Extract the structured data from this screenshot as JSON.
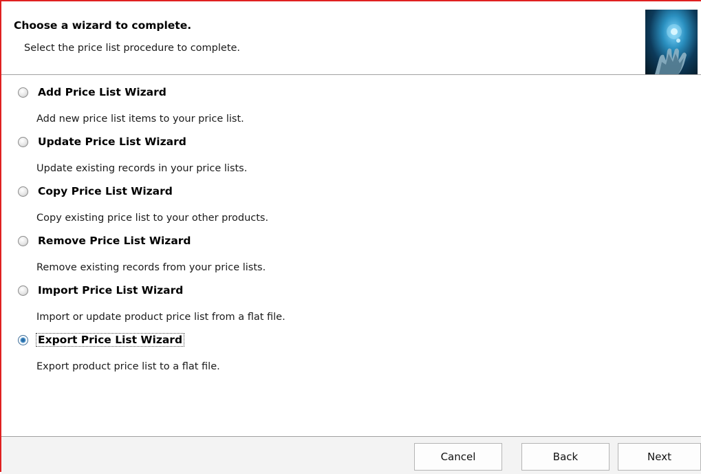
{
  "header": {
    "title": "Choose a wizard to complete.",
    "subtitle": "Select the price list procedure to complete."
  },
  "options": [
    {
      "title": "Add Price List Wizard",
      "description": "Add new price list items to your price list.",
      "selected": false
    },
    {
      "title": "Update Price List Wizard",
      "description": "Update existing records in your price lists.",
      "selected": false
    },
    {
      "title": "Copy Price List Wizard",
      "description": "Copy existing price list to your other products.",
      "selected": false
    },
    {
      "title": "Remove Price List Wizard",
      "description": "Remove existing records from your price lists.",
      "selected": false
    },
    {
      "title": "Import Price List Wizard",
      "description": "Import or update product price list from a flat file.",
      "selected": false
    },
    {
      "title": "Export Price List Wizard",
      "description": "Export product price list to a flat file.",
      "selected": true
    }
  ],
  "footer": {
    "cancel_label": "Cancel",
    "back_label": "Back",
    "next_label": "Next"
  },
  "colors": {
    "window_border": "#e02020",
    "selected_radio": "#3d86c2"
  },
  "icons": {
    "header_image": "hand-with-light-image"
  }
}
